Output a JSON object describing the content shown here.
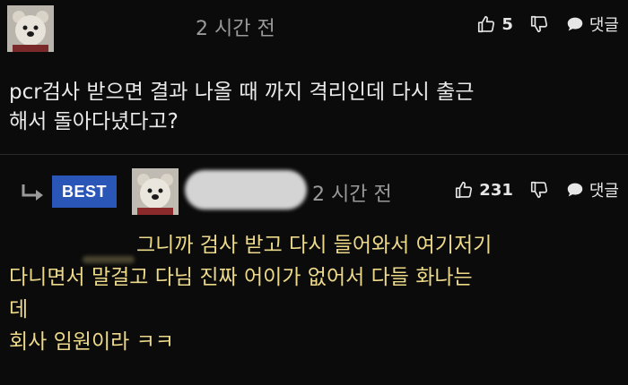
{
  "comment": {
    "time": "2 시간 전",
    "likes": "5",
    "reply_label": "댓글",
    "body_lines": [
      "pcr검사 받으면 결과 나올 때 까지 격리인데 다시 출근",
      "해서 돌아다녔다고?"
    ]
  },
  "reply": {
    "badge": "BEST",
    "time": "2 시간 전",
    "likes": "231",
    "reply_label": "댓글",
    "body_lines": [
      "그니까 검사 받고 다시 들어와서 여기저기",
      "다니면서 말걸고 다님 진짜 어이가 없어서 다들 화나는",
      "데",
      "회사 임원이라 ㅋㅋ"
    ]
  },
  "icons": {
    "like": "thumbs-up-icon",
    "dislike": "thumbs-down-icon",
    "reply": "speech-bubble-icon",
    "reply_indicator": "reply-arrow-icon"
  },
  "colors": {
    "background": "#0b0b0b",
    "best_badge": "#2a56b8",
    "best_text": "#ecd98a"
  }
}
